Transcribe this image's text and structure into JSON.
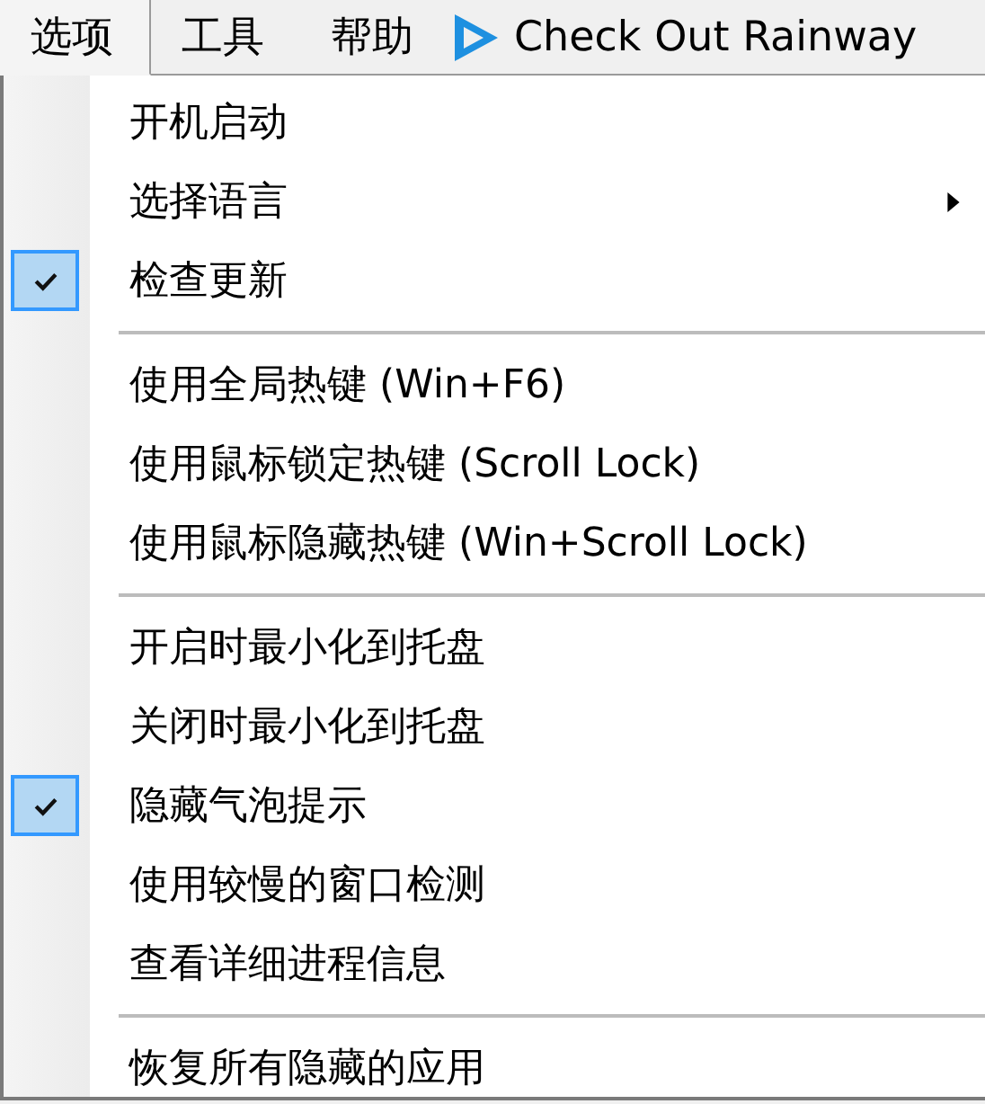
{
  "menubar": [
    {
      "label": "选项",
      "selected": true,
      "kind": "menu"
    },
    {
      "label": "工具",
      "selected": false,
      "kind": "menu"
    },
    {
      "label": "帮助",
      "selected": false,
      "kind": "menu"
    },
    {
      "label": "Check Out Rainway",
      "selected": false,
      "kind": "link"
    }
  ],
  "menu": [
    {
      "kind": "item",
      "label": "开机启动",
      "checked": false,
      "submenu": false
    },
    {
      "kind": "item",
      "label": "选择语言",
      "checked": false,
      "submenu": true
    },
    {
      "kind": "item",
      "label": "检查更新",
      "checked": true,
      "submenu": false
    },
    {
      "kind": "separator"
    },
    {
      "kind": "item",
      "label": "使用全局热键 (Win+F6)",
      "checked": false,
      "submenu": false
    },
    {
      "kind": "item",
      "label": "使用鼠标锁定热键 (Scroll Lock)",
      "checked": false,
      "submenu": false
    },
    {
      "kind": "item",
      "label": "使用鼠标隐藏热键 (Win+Scroll Lock)",
      "checked": false,
      "submenu": false
    },
    {
      "kind": "separator"
    },
    {
      "kind": "item",
      "label": "开启时最小化到托盘",
      "checked": false,
      "submenu": false
    },
    {
      "kind": "item",
      "label": "关闭时最小化到托盘",
      "checked": false,
      "submenu": false
    },
    {
      "kind": "item",
      "label": "隐藏气泡提示",
      "checked": true,
      "submenu": false
    },
    {
      "kind": "item",
      "label": "使用较慢的窗口检测",
      "checked": false,
      "submenu": false
    },
    {
      "kind": "item",
      "label": "查看详细进程信息",
      "checked": false,
      "submenu": false
    },
    {
      "kind": "separator"
    },
    {
      "kind": "item",
      "label": "恢复所有隐藏的应用",
      "checked": false,
      "submenu": false
    }
  ]
}
